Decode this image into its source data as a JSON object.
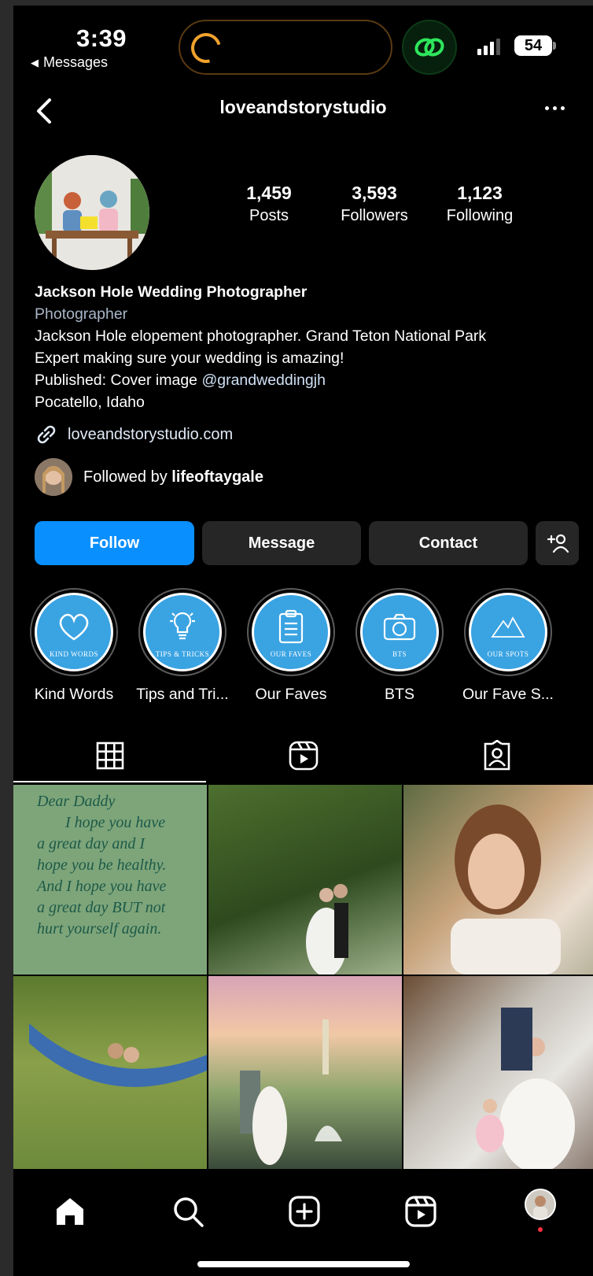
{
  "status_bar": {
    "time": "3:39",
    "back_app": "Messages",
    "battery": "54"
  },
  "header": {
    "username": "loveandstorystudio"
  },
  "stats": [
    {
      "value": "1,459",
      "label": "Posts"
    },
    {
      "value": "3,593",
      "label": "Followers"
    },
    {
      "value": "1,123",
      "label": "Following"
    }
  ],
  "bio": {
    "name": "Jackson Hole Wedding Photographer",
    "category": "Photographer",
    "line1": "Jackson Hole elopement photographer. Grand Teton National Park",
    "line2": "Expert making sure your wedding is amazing!",
    "line3_prefix": "Published: Cover image ",
    "line3_mention": "@grandweddingjh",
    "line4": "Pocatello, Idaho",
    "website": "loveandstorystudio.com",
    "followed_by_prefix": "Followed by ",
    "followed_by_user": "lifeoftaygale"
  },
  "buttons": {
    "follow": "Follow",
    "message": "Message",
    "contact": "Contact"
  },
  "highlights": [
    {
      "label": "Kind Words",
      "badge": "KIND WORDS"
    },
    {
      "label": "Tips and Tri...",
      "badge": "TIPS & TRICKS"
    },
    {
      "label": "Our Faves",
      "badge": "OUR FAVES"
    },
    {
      "label": "BTS",
      "badge": "BTS"
    },
    {
      "label": "Our Fave S...",
      "badge": "OUR SPOTS"
    }
  ],
  "grid": {
    "note_text": [
      "Dear Daddy",
      "I hope you have",
      "a great day and I",
      "hope you be healthy.",
      "And I hope you have",
      "a great day BUT not",
      "hurt yourself again."
    ]
  },
  "colors": {
    "follow_button": "#0a8fff",
    "secondary_button": "#262626",
    "highlight_disc": "#3aa3e2",
    "notification_dot": "#ff3040"
  }
}
